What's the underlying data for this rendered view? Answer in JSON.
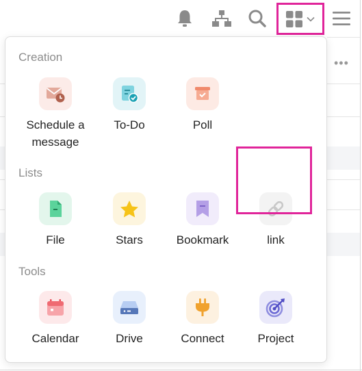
{
  "topbar": {
    "icons": [
      "bell-icon",
      "org-chart-icon",
      "search-icon",
      "apps-grid-icon",
      "chevron-down-icon",
      "hamburger-menu-icon"
    ]
  },
  "popover": {
    "sections": {
      "creation": {
        "title": "Creation",
        "items": {
          "schedule": {
            "label": "Schedule a message",
            "icon": "scheduled-mail-icon"
          },
          "todo": {
            "label": "To-Do",
            "icon": "todo-icon"
          },
          "poll": {
            "label": "Poll",
            "icon": "poll-box-icon"
          }
        }
      },
      "lists": {
        "title": "Lists",
        "items": {
          "file": {
            "label": "File",
            "icon": "file-icon"
          },
          "stars": {
            "label": "Stars",
            "icon": "star-icon"
          },
          "bookmark": {
            "label": "Bookmark",
            "icon": "bookmark-icon"
          },
          "link": {
            "label": "link",
            "icon": "link-icon"
          }
        }
      },
      "tools": {
        "title": "Tools",
        "items": {
          "calendar": {
            "label": "Calendar",
            "icon": "calendar-icon"
          },
          "drive": {
            "label": "Drive",
            "icon": "drive-icon"
          },
          "connect": {
            "label": "Connect",
            "icon": "plug-icon"
          },
          "project": {
            "label": "Project",
            "icon": "target-icon"
          }
        }
      }
    }
  },
  "background": {
    "more_indicator": "•••"
  },
  "colors": {
    "highlight": "#e0249a",
    "section_title": "#8c8c8c",
    "icon_gray": "#8a8a8a"
  }
}
